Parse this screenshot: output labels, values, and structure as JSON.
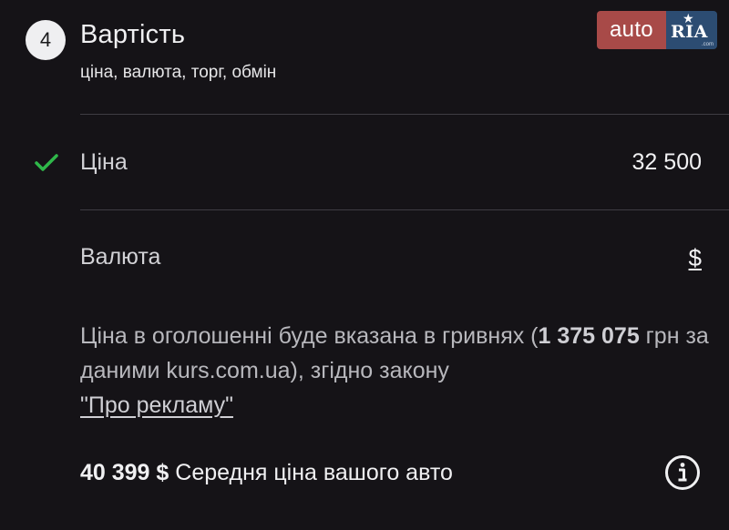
{
  "section": {
    "step_number": "4",
    "title": "Вартість",
    "subtitle": "ціна, валюта, торг, обмін"
  },
  "logo": {
    "left": "auto",
    "right": "RIA",
    "domain": ".com"
  },
  "price": {
    "label": "Ціна",
    "value": "32 500",
    "status_icon": "check-icon",
    "status_color": "#2fb84a"
  },
  "currency": {
    "label": "Валюта",
    "value": "$"
  },
  "notice": {
    "text_before": "Ціна в оголошенні буде вказана в гривнях (",
    "amount": "1 375 075",
    "text_after": " грн за даними kurs.com.ua), згідно закону ",
    "link": "\"Про рекламу\""
  },
  "average": {
    "amount": "40 399 $",
    "label": " Середня ціна вашого авто",
    "icon": "info-icon"
  },
  "colors": {
    "background": "#151317",
    "logo_auto": "#a84a48",
    "logo_ria": "#2c4c72"
  }
}
